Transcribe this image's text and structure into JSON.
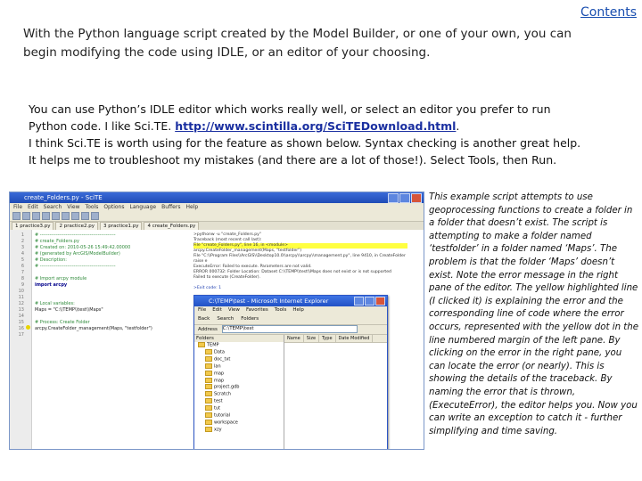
{
  "header": {
    "contents_link": "Contents"
  },
  "intro": "With the Python language script created by the Model Builder, or one of your own, you can begin modifying the code using IDLE, or an editor of your choosing.",
  "body": {
    "line1": "You can use Python’s IDLE editor which works really well, or select an editor you prefer to run",
    "line2_pre": "Python code. I like Sci.TE. ",
    "link": "http://www.scintilla.org/SciTEDownload.html",
    "line2_post": ".",
    "line3": "I think Sci.TE is worth using for the feature as shown below. Syntax checking is another great help.",
    "line4": "It helps me to troubleshoot my mistakes (and there are a lot of those!). Select Tools, then Run."
  },
  "caption": "This example script attempts to use geoprocessing functions to create a folder in a folder that doesn’t exist. The script is attempting to make a folder named ‘testfolder’ in a folder named ‘Maps’. The problem is that the folder ‘Maps’ doesn’t exist. Note the error message in the right pane of the editor. The yellow highlighted line (I clicked it) is explaining the error and the corresponding line of code where the error occurs, represented with the yellow dot in the line numbered margin of the left pane. By clicking on the error in the right pane, you can locate the error (or nearly). This is showing the details of the traceback. By naming the error that is thrown, (ExecuteError), the editor helps you. Now you can write an exception to catch it - further simplifying and time saving.",
  "screenshot": {
    "scite_title": "create_Folders.py - SciTE",
    "scite_menu": [
      "File",
      "Edit",
      "Search",
      "View",
      "Tools",
      "Options",
      "Language",
      "Buffers",
      "Help"
    ],
    "scite_tabs": [
      "1 practice3.py",
      "2 practice2.py",
      "3 practice1.py",
      "4 create_Folders.py"
    ],
    "code_lines": [
      {
        "n": "1",
        "t": "# -----------------------------------------------",
        "k": "cm"
      },
      {
        "n": "2",
        "t": "# create_Folders.py",
        "k": "cm"
      },
      {
        "n": "3",
        "t": "# Created on: 2010-05-26 15:49:42.00000",
        "k": "cm"
      },
      {
        "n": "4",
        "t": "#   (generated by ArcGIS/ModelBuilder)",
        "k": "cm"
      },
      {
        "n": "5",
        "t": "# Description:",
        "k": "cm"
      },
      {
        "n": "6",
        "t": "# -----------------------------------------------",
        "k": "cm"
      },
      {
        "n": "7",
        "t": "",
        "k": "cd"
      },
      {
        "n": "8",
        "t": "# Import arcpy module",
        "k": "cm"
      },
      {
        "n": "9",
        "t": "import arcpy",
        "k": "kw"
      },
      {
        "n": "10",
        "t": "",
        "k": "cd"
      },
      {
        "n": "11",
        "t": "",
        "k": "cd"
      },
      {
        "n": "12",
        "t": "# Local variables:",
        "k": "cm"
      },
      {
        "n": "13",
        "t": "Maps = \"C:\\\\TEMP\\\\test\\\\Maps\"",
        "k": "cd"
      },
      {
        "n": "14",
        "t": "",
        "k": "cd"
      },
      {
        "n": "15",
        "t": "# Process: Create Folder",
        "k": "cm"
      },
      {
        "n": "16",
        "t": "arcpy.CreateFolder_management(Maps, \"testfolder\")",
        "k": "cd"
      },
      {
        "n": "17",
        "t": "",
        "k": "cd"
      }
    ],
    "output_lines": [
      {
        "t": ">pythonw -u \"create_Folders.py\"",
        "k": ""
      },
      {
        "t": "Traceback (most recent call last):",
        "k": ""
      },
      {
        "t": "  File \"create_Folders.py\", line 16, in <module>",
        "k": "hl"
      },
      {
        "t": "    arcpy.CreateFolder_management(Maps, \"testfolder\")",
        "k": ""
      },
      {
        "t": "  File \"C:\\\\Program Files\\\\ArcGIS\\\\Desktop10.0\\\\arcpy\\\\arcpy\\\\management.py\", line 9410, in CreateFolder",
        "k": ""
      },
      {
        "t": "    raise e",
        "k": ""
      },
      {
        "t": "ExecuteError: Failed to execute. Parameters are not valid.",
        "k": ""
      },
      {
        "t": "ERROR 000732: Folder Location: Dataset C:\\\\TEMP\\\\test\\\\Maps does not exist or is not supported",
        "k": ""
      },
      {
        "t": "Failed to execute (CreateFolder).",
        "k": ""
      },
      {
        "t": "",
        "k": ""
      },
      {
        "t": ">Exit code: 1",
        "k": "blue"
      }
    ],
    "explorer_title": "C:\\TEMP\\test - Microsoft Internet Explorer",
    "explorer_menu": [
      "File",
      "Edit",
      "View",
      "Favorites",
      "Tools",
      "Help"
    ],
    "explorer_toolbar": [
      "Back",
      "Search",
      "Folders"
    ],
    "explorer_address_label": "Address",
    "explorer_address": "C:\\TEMP\\test",
    "folders_header": "Folders",
    "folder_tree": [
      "TEMP",
      "Data",
      "doc_txt",
      "lan",
      "map",
      "map",
      "project.gdb",
      "Scratch",
      "test",
      "tut",
      "tutorial",
      "workspace",
      "xzy"
    ],
    "explorer_columns": [
      "Name",
      "Size",
      "Type",
      "Date Modified"
    ]
  }
}
